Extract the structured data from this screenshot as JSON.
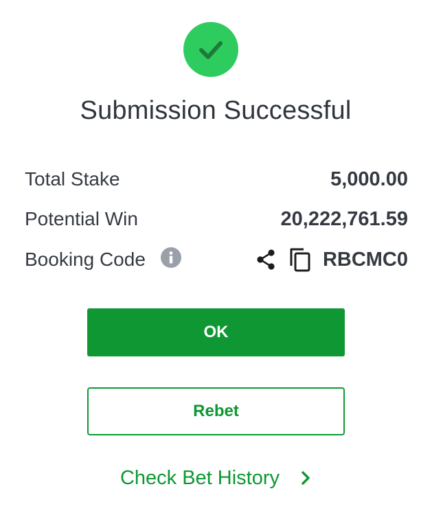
{
  "status": {
    "icon": "check-icon",
    "title": "Submission Successful",
    "color": "#2ecc5f"
  },
  "summary": {
    "total_stake": {
      "label": "Total Stake",
      "value": "5,000.00"
    },
    "potential_win": {
      "label": "Potential Win",
      "value": "20,222,761.59"
    },
    "booking_code": {
      "label": "Booking Code",
      "info_icon": "info-icon",
      "share_icon": "share-icon",
      "copy_icon": "copy-icon",
      "value": "RBCMC0"
    }
  },
  "actions": {
    "ok_label": "OK",
    "rebet_label": "Rebet",
    "history_label": "Check Bet History",
    "history_icon": "chevron-right-icon",
    "accent": "#0e9733"
  }
}
